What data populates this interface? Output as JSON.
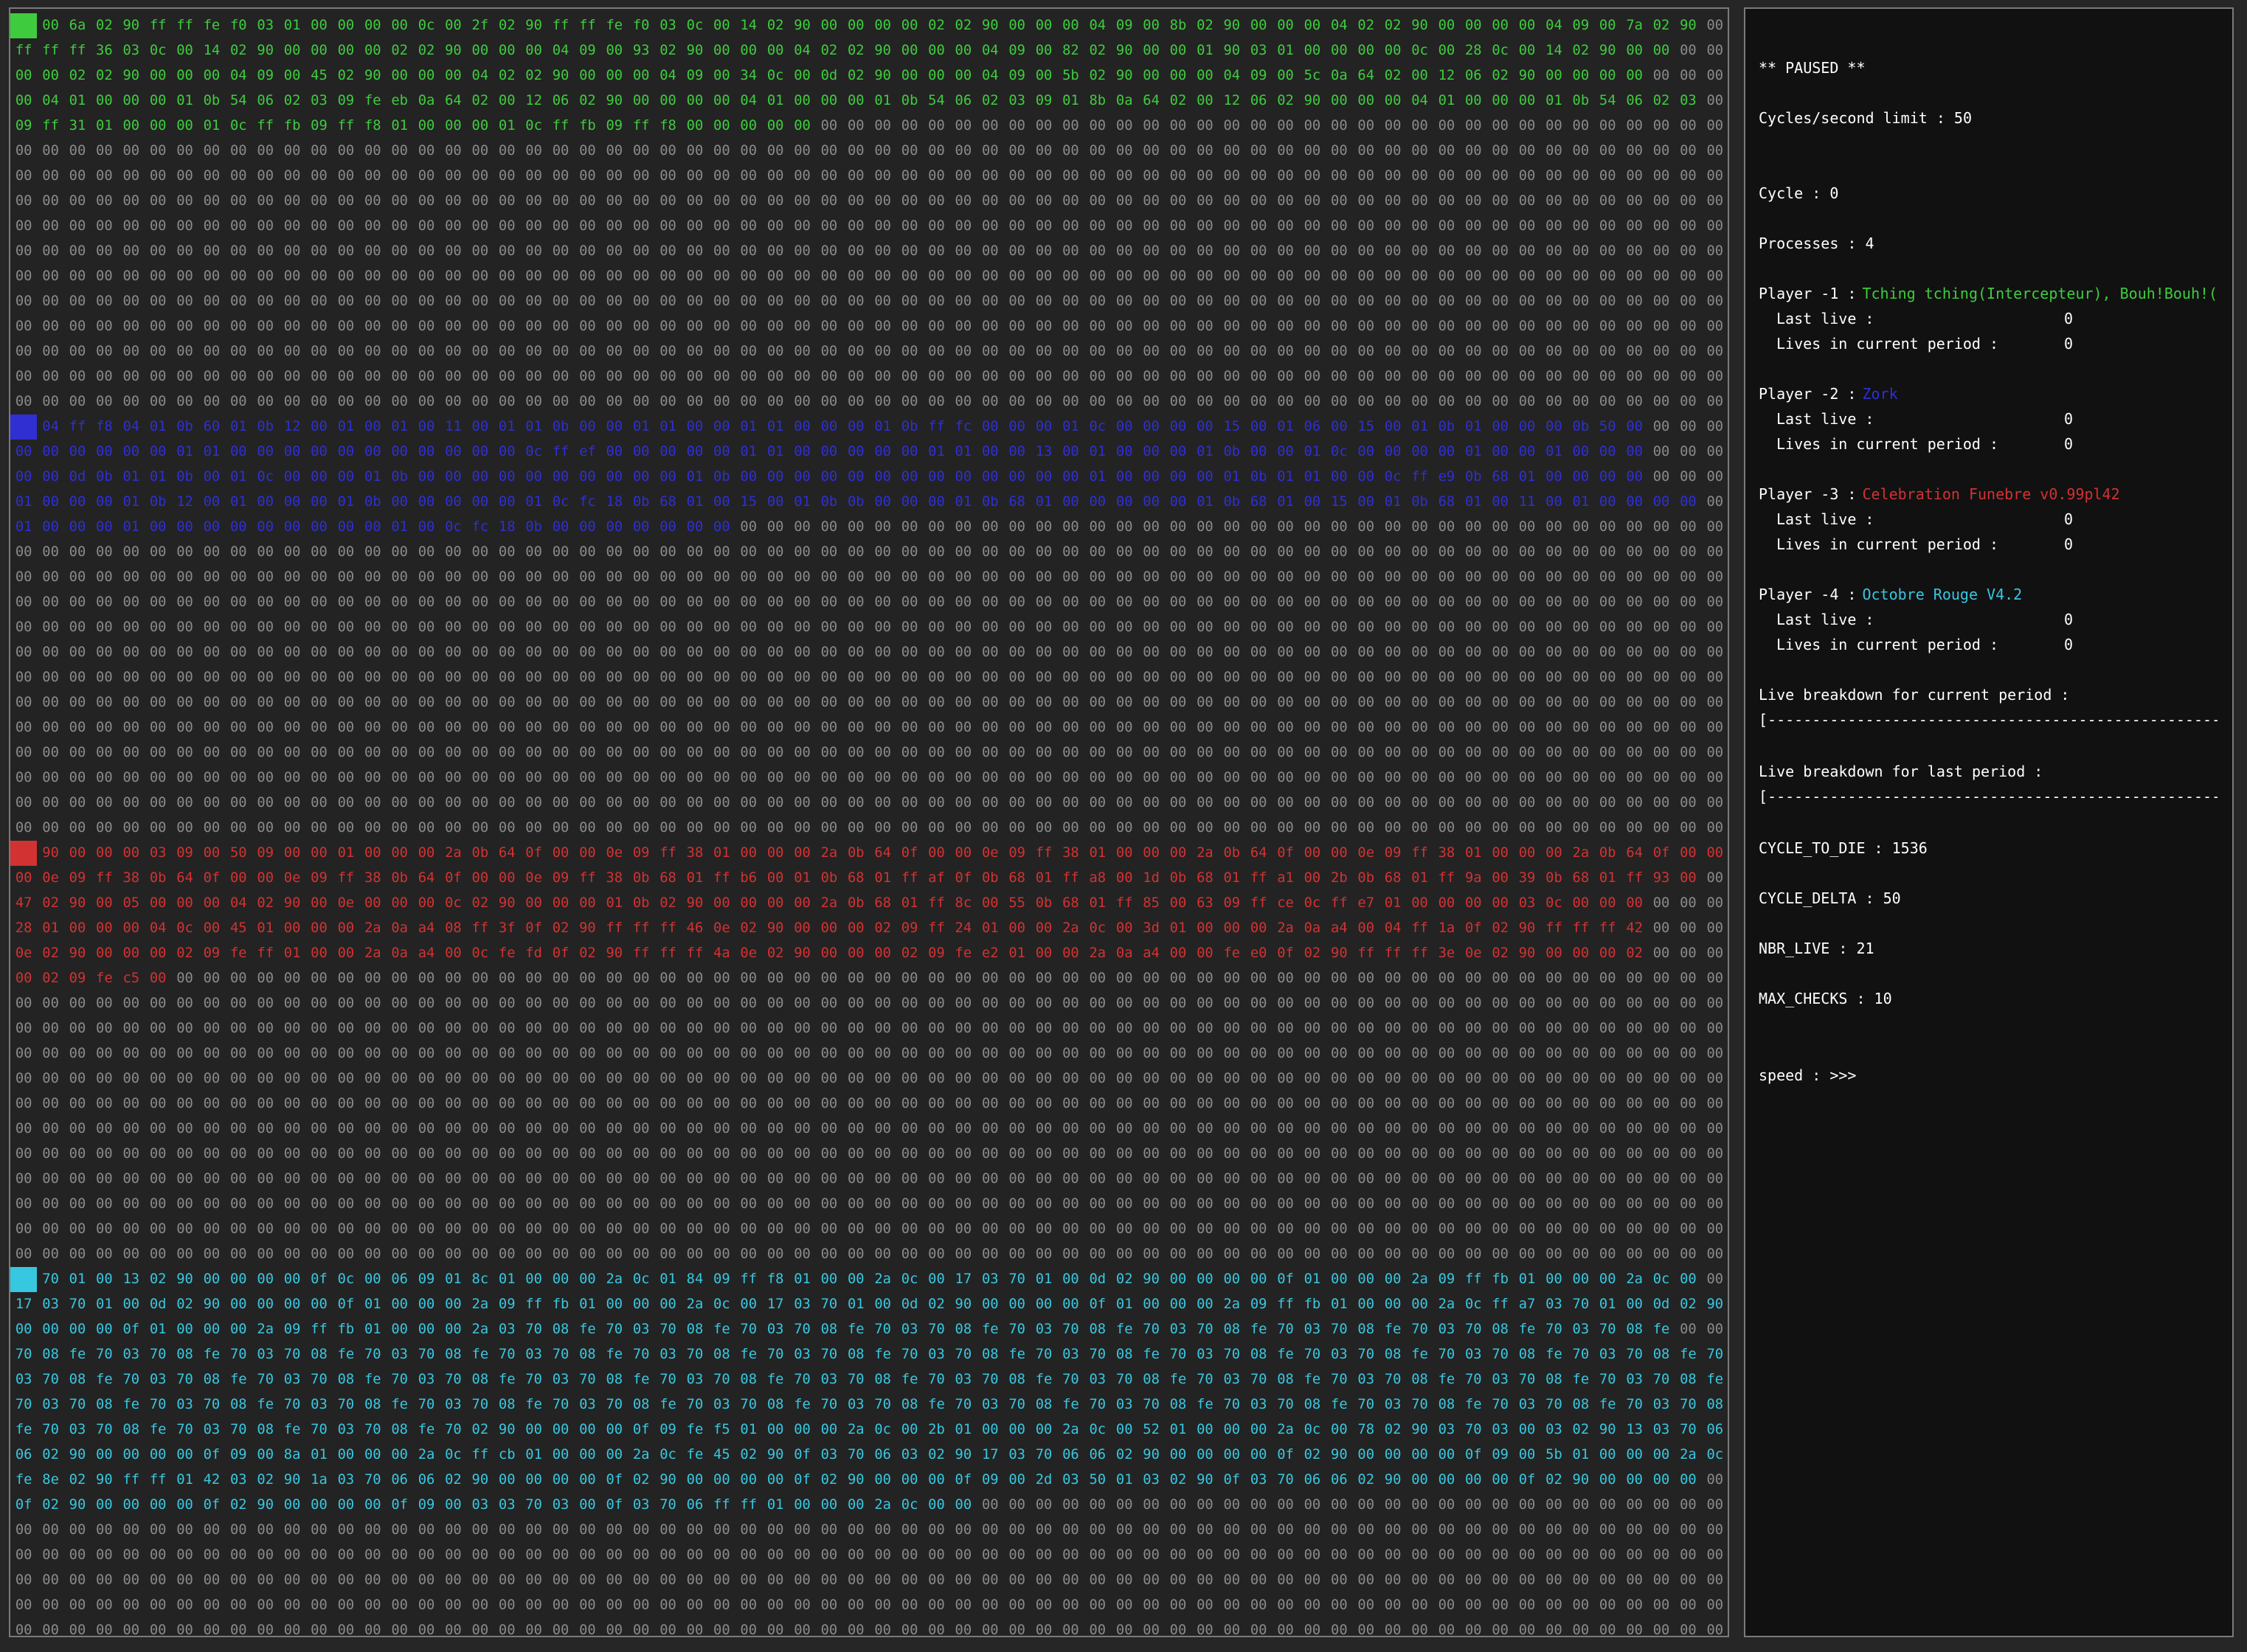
{
  "colors": {
    "player1": "#3ecc3e",
    "player2": "#2f2fd2",
    "player3": "#d23232",
    "player4": "#38c7e0",
    "empty": "#8a8a8a",
    "background": "#232323"
  },
  "arena": {
    "rows": [
      {
        "owner": 1,
        "bytes": "0c 00 6a 02 90 ff ff fe f0 03 01 00 00 00 00 0c 00 2f 02 90 ff ff fe f0 03 0c 00 14 02 90 00 00 00 00 02 02 90 00 00 00 04 09 00 8b 02 90 00 00 00 04 02 02 90 00 00 00 00 04 09 00 7a 02 90"
      },
      {
        "owner": 1,
        "bytes": "ff ff ff 36 03 0c 00 14 02 90 00 00 00 00 02 02 90 00 00 00 04 09 00 93 02 90 00 00 00 04 02 02 90 00 00 00 04 09 00 82 02 90 00 00 01 90 03 01 00 00 00 00 0c 00 28 0c 00 14 02 90 00 00"
      },
      {
        "owner": 1,
        "bytes": "00 00 02 02 90 00 00 00 04 09 00 45 02 90 00 00 00 04 02 02 90 00 00 00 04 09 00 34 0c 00 0d 02 90 00 00 00 04 09 00 5b 02 90 00 00 00 04 09 00 5c 0a 64 02 00 12 06 02 90 00 00 00 00"
      },
      {
        "owner": 1,
        "bytes": "00 04 01 00 00 00 01 0b 54 06 02 03 09 fe eb 0a 64 02 00 12 06 02 90 00 00 00 00 04 01 00 00 00 01 0b 54 06 02 03 09 01 8b 0a 64 02 00 12 06 02 90 00 00 00 04 01 00 00 00 01 0b 54 06 02 03"
      },
      {
        "owner": 1,
        "len": 30,
        "bytes": "09 ff 31 01 00 00 00 01 0c ff fb 09 ff f8 01 00 00 00 01 0c ff fb 09 ff f8 00 00 00 00 00"
      },
      {
        "owner": 0
      },
      {
        "owner": 0
      },
      {
        "owner": 0
      },
      {
        "owner": 0
      },
      {
        "owner": 0
      },
      {
        "owner": 0
      },
      {
        "owner": 0
      },
      {
        "owner": 0
      },
      {
        "owner": 0
      },
      {
        "owner": 0
      },
      {
        "owner": 0
      },
      {
        "owner": 2,
        "bytes": "0a 04 ff f8 04 01 0b 60 01 0b 12 00 01 00 01 00 11 00 01 01 0b 00 00 01 01 00 00 01 01 00 00 00 01 0b ff fc 00 00 00 01 0c 00 00 00 00 15 00 01 06 00 15 00 01 0b 01 00 00 00 0b 50 00"
      },
      {
        "owner": 2,
        "bytes": "00 00 00 00 00 00 01 01 00 00 00 00 00 00 00 00 00 00 00 0c ff ef 00 00 00 00 00 01 01 00 00 00 00 00 01 01 00 00 13 00 01 00 00 00 01 0b 00 00 01 0c 00 00 00 00 01 00 00 01 00 00 00"
      },
      {
        "owner": 2,
        "bytes": "00 00 0d 0b 01 01 0b 00 01 0c 00 00 00 01 0b 00 00 00 00 00 00 00 00 00 00 01 0b 00 00 00 00 00 00 00 00 00 00 00 00 00 01 00 00 00 00 01 0b 01 01 00 00 0c ff e9 0b 68 01 00 00 00 00"
      },
      {
        "owner": 2,
        "bytes": "01 00 00 00 01 0b 12 00 01 00 00 00 01 0b 00 00 00 00 00 01 0c fc 18 0b 68 01 00 15 00 01 0b 0b 00 00 00 01 0b 68 01 00 00 00 00 00 01 0b 68 01 00 15 00 01 0b 68 01 00 11 00 01 00 00 00 00"
      },
      {
        "owner": 2,
        "len": 27,
        "bytes": "01 00 00 00 01 00 00 00 00 00 00 00 00 00 01 00 0c fc 18 0b 00 00 00 00 00 00 00"
      },
      {
        "owner": 0
      },
      {
        "owner": 0
      },
      {
        "owner": 0
      },
      {
        "owner": 0
      },
      {
        "owner": 0
      },
      {
        "owner": 0
      },
      {
        "owner": 0
      },
      {
        "owner": 0
      },
      {
        "owner": 0
      },
      {
        "owner": 0
      },
      {
        "owner": 0
      },
      {
        "owner": 0
      },
      {
        "owner": 3,
        "bytes": "02 90 00 00 00 03 09 00 50 09 00 00 01 00 00 00 2a 0b 64 0f 00 00 0e 09 ff 38 01 00 00 00 2a 0b 64 0f 00 00 0e 09 ff 38 01 00 00 00 2a 0b 64 0f 00 00 0e 09 ff 38 01 00 00 00 2a 0b 64 0f 00 00"
      },
      {
        "owner": 3,
        "bytes": "00 0e 09 ff 38 0b 64 0f 00 00 0e 09 ff 38 0b 64 0f 00 00 0e 09 ff 38 0b 68 01 ff b6 00 01 0b 68 01 ff af 0f 0b 68 01 ff a8 00 1d 0b 68 01 ff a1 00 2b 0b 68 01 ff 9a 00 39 0b 68 01 ff 93 00"
      },
      {
        "owner": 3,
        "bytes": "47 02 90 00 05 00 00 00 04 02 90 00 0e 00 00 00 0c 02 90 00 00 00 01 0b 02 90 00 00 00 00 2a 0b 68 01 ff 8c 00 55 0b 68 01 ff 85 00 63 09 ff ce 0c ff e7 01 00 00 00 00 03 0c 00 00 00"
      },
      {
        "owner": 3,
        "bytes": "28 01 00 00 00 04 0c 00 45 01 00 00 00 2a 0a a4 08 ff 3f 0f 02 90 ff ff ff 46 0e 02 90 00 00 00 02 09 ff 24 01 00 00 2a 0c 00 3d 01 00 00 00 2a 0a a4 00 04 ff 1a 0f 02 90 ff ff ff 42"
      },
      {
        "owner": 3,
        "bytes": "0e 02 90 00 00 00 02 09 fe ff 01 00 00 2a 0a a4 00 0c fe fd 0f 02 90 ff ff ff 4a 0e 02 90 00 00 00 02 09 fe e2 01 00 00 2a 0a a4 00 00 fe e0 0f 02 90 ff ff ff 3e 0e 02 90 00 00 00 02"
      },
      {
        "owner": 3,
        "len": 6,
        "bytes": "00 02 09 fe c5 00"
      },
      {
        "owner": 0
      },
      {
        "owner": 0
      },
      {
        "owner": 0
      },
      {
        "owner": 0
      },
      {
        "owner": 0
      },
      {
        "owner": 0
      },
      {
        "owner": 0
      },
      {
        "owner": 0
      },
      {
        "owner": 0
      },
      {
        "owner": 0
      },
      {
        "owner": 0
      },
      {
        "owner": 4,
        "bytes": "02 70 01 00 13 02 90 00 00 00 00 0f 0c 00 06 09 01 8c 01 00 00 00 2a 0c 01 84 09 ff f8 01 00 00 2a 0c 00 17 03 70 01 00 0d 02 90 00 00 00 00 0f 01 00 00 00 2a 09 ff fb 01 00 00 00 2a 0c 00"
      },
      {
        "owner": 4,
        "bytes": "17 03 70 01 00 0d 02 90 00 00 00 00 0f 01 00 00 00 2a 09 ff fb 01 00 00 00 2a 0c 00 17 03 70 01 00 0d 02 90 00 00 00 00 0f 01 00 00 00 2a 09 ff fb 01 00 00 00 2a 0c ff a7 03 70 01 00 0d 02 90"
      },
      {
        "owner": 4,
        "bytes": "00 00 00 00 0f 01 00 00 00 2a 09 ff fb 01 00 00 00 2a 03 70 08 fe 70 03 70 08 fe 70 03 70 08 fe 70 03 70 08 fe 70 03 70 08 fe 70 03 70 08 fe 70 03 70 08 fe 70 03 70 08 fe 70 03 70 08 fe"
      },
      {
        "owner": 4,
        "bytes": "70 08 fe 70 03 70 08 fe 70 03 70 08 fe 70 03 70 08 fe 70 03 70 08 fe 70 03 70 08 fe 70 03 70 08 fe 70 03 70 08 fe 70 03 70 08 fe 70 03 70 08 fe 70 03 70 08 fe 70 03 70 08 fe 70 03 70 08 fe 70"
      },
      {
        "owner": 4,
        "bytes": "03 70 08 fe 70 03 70 08 fe 70 03 70 08 fe 70 03 70 08 fe 70 03 70 08 fe 70 03 70 08 fe 70 03 70 08 fe 70 03 70 08 fe 70 03 70 08 fe 70 03 70 08 fe 70 03 70 08 fe 70 03 70 08 fe 70 03 70 08 fe"
      },
      {
        "owner": 4,
        "bytes": "70 03 70 08 fe 70 03 70 08 fe 70 03 70 08 fe 70 03 70 08 fe 70 03 70 08 fe 70 03 70 08 fe 70 03 70 08 fe 70 03 70 08 fe 70 03 70 08 fe 70 03 70 08 fe 70 03 70 08 fe 70 03 70 08 fe 70 03 70 08"
      },
      {
        "owner": 4,
        "bytes": "fe 70 03 70 08 fe 70 03 70 08 fe 70 03 70 08 fe 70 02 90 00 00 00 00 0f 09 fe f5 01 00 00 00 2a 0c 00 2b 01 00 00 00 2a 0c 00 52 01 00 00 00 2a 0c 00 78 02 90 03 70 03 00 03 02 90 13 03 70 06"
      },
      {
        "owner": 4,
        "bytes": "06 02 90 00 00 00 00 0f 09 00 8a 01 00 00 00 2a 0c ff cb 01 00 00 00 2a 0c fe 45 02 90 0f 03 70 06 03 02 90 17 03 70 06 06 02 90 00 00 00 00 0f 02 90 00 00 00 00 0f 09 00 5b 01 00 00 00 2a 0c"
      },
      {
        "owner": 4,
        "bytes": "fe 8e 02 90 ff ff 01 42 03 02 90 1a 03 70 06 06 02 90 00 00 00 00 0f 02 90 00 00 00 00 0f 02 90 00 00 00 0f 09 00 2d 03 50 01 03 02 90 0f 03 70 06 06 02 90 00 00 00 00 0f 02 90 00 00 00 00"
      },
      {
        "owner": 4,
        "len": 36,
        "bytes": "0f 02 90 00 00 00 00 0f 02 90 00 00 00 00 0f 09 00 03 03 70 03 00 0f 03 70 06 ff ff 01 00 00 00 2a 0c 00 00"
      },
      {
        "owner": 0
      },
      {
        "owner": 0
      },
      {
        "owner": 0
      },
      {
        "owner": 0
      },
      {
        "owner": 0
      },
      {
        "owner": 0
      }
    ]
  },
  "sidebar": {
    "paused": "** PAUSED **",
    "cycles_limit_label": "Cycles/second limit : ",
    "cycles_limit": "50",
    "cycle_label": "Cycle : ",
    "cycle": "0",
    "processes_label": "Processes : ",
    "processes": "4",
    "last_live_label": "Last live :",
    "lives_period_label": "Lives in current period :",
    "players": [
      {
        "label": "Player -1 :",
        "name": "Tching tching(Intercepteur), Bouh!Bouh!(",
        "last_live": "0",
        "lives": "0"
      },
      {
        "label": "Player -2 :",
        "name": "Zork",
        "last_live": "0",
        "lives": "0"
      },
      {
        "label": "Player -3 :",
        "name": "Celebration Funebre v0.99pl42",
        "last_live": "0",
        "lives": "0"
      },
      {
        "label": "Player -4 :",
        "name": "Octobre Rouge V4.2",
        "last_live": "0",
        "lives": "0"
      }
    ],
    "breakdown_current_label": "Live breakdown for current period :",
    "breakdown_current_bar": "[--------------------------------------------------------------------------]",
    "breakdown_last_label": "Live breakdown for last period :",
    "breakdown_last_bar": "[--------------------------------------------------------------------------]",
    "cycle_to_die_label": "CYCLE_TO_DIE : ",
    "cycle_to_die": "1536",
    "cycle_delta_label": "CYCLE_DELTA : ",
    "cycle_delta": "50",
    "nbr_live_label": "NBR_LIVE : ",
    "nbr_live": "21",
    "max_checks_label": "MAX_CHECKS : ",
    "max_checks": "10",
    "speed_label": "speed : ",
    "speed": ">>>"
  }
}
